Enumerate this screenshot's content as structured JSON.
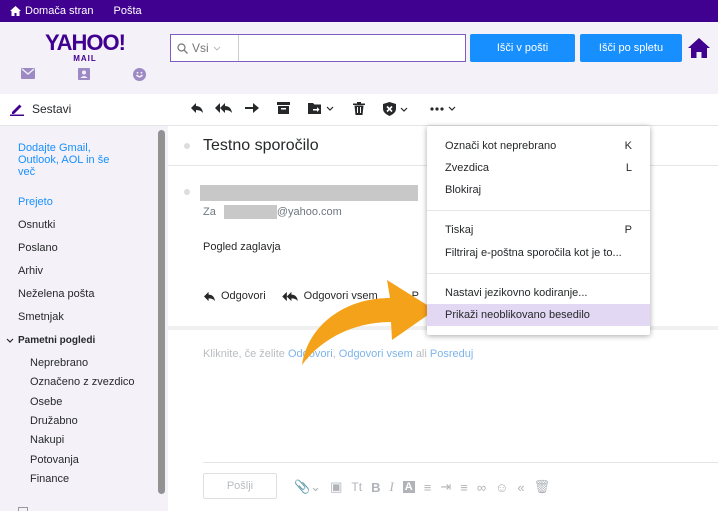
{
  "topbar": {
    "home_label": "Domača stran",
    "mail_label": "Pošta"
  },
  "logo": {
    "brand": "YAHOO!",
    "product": "MAIL"
  },
  "search": {
    "scope_label": "Vsi",
    "value": "",
    "search_mail_label": "Išči v pošti",
    "search_web_label": "Išči po spletu"
  },
  "toolbar": {
    "compose_label": "Sestavi"
  },
  "sidebar": {
    "promo": "Dodajte Gmail, Outlook, AOL in še več",
    "folders": [
      {
        "label": "Prejeto",
        "active": true
      },
      {
        "label": "Osnutki",
        "active": false
      },
      {
        "label": "Poslano",
        "active": false
      },
      {
        "label": "Arhiv",
        "active": false
      },
      {
        "label": "Neželena pošta",
        "active": false
      },
      {
        "label": "Smetnjak",
        "active": false
      }
    ],
    "smart_views_label": "Pametni pogledi",
    "smart_views": [
      "Neprebrano",
      "Označeno z zvezdico",
      "Osebe",
      "Družabno",
      "Nakupi",
      "Potovanja",
      "Finance"
    ]
  },
  "message": {
    "subject": "Testno sporočilo",
    "to_prefix": "Za",
    "to_address": "@yahoo.com",
    "view_header": "Pogled zaglavja",
    "reply_label": "Odgovori",
    "reply_all_label": "Odgovori vsem",
    "forward_label": "P",
    "hint_prefix": "Kliknite, če želite",
    "hint_reply": "Odgovori",
    "hint_sep1": ",",
    "hint_reply_all": "Odgovori vsem",
    "hint_or": "ali",
    "hint_forward": "Posreduj",
    "send_label": "Pošlji"
  },
  "menu": {
    "items": [
      {
        "label": "Označi kot neprebrano",
        "shortcut": "K"
      },
      {
        "label": "Zvezdica",
        "shortcut": "L"
      },
      {
        "label": "Blokiraj",
        "shortcut": ""
      },
      {
        "label": "Tiskaj",
        "shortcut": "P"
      },
      {
        "label": "Filtriraj e-poštna sporočila kot je to...",
        "shortcut": ""
      },
      {
        "label": "Nastavi jezikovno kodiranje...",
        "shortcut": ""
      },
      {
        "label": "Prikaži neoblikovano besedilo",
        "shortcut": "",
        "highlighted": true
      }
    ]
  },
  "colors": {
    "brand_purple": "#400090",
    "accent_blue": "#188fff",
    "menu_highlight": "#e2d8f4",
    "arrow_orange": "#f5a21b"
  }
}
